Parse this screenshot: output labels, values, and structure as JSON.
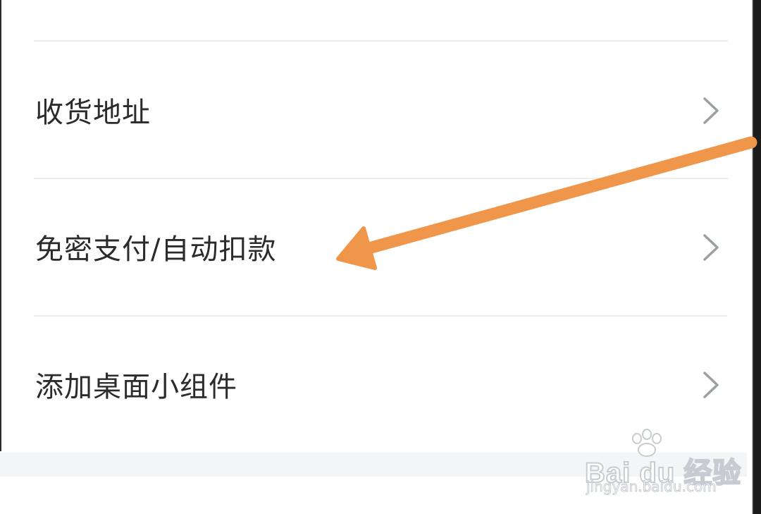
{
  "menu": {
    "items": [
      {
        "label": "收货地址",
        "chevron_icon": "chevron-right-icon"
      },
      {
        "label": "免密支付/自动扣款",
        "chevron_icon": "chevron-right-icon"
      },
      {
        "label": "添加桌面小组件",
        "chevron_icon": "chevron-right-icon"
      }
    ]
  },
  "annotation": {
    "arrow_color": "#F0964A",
    "points_to": "免密支付/自动扣款"
  },
  "watermark": {
    "brand": "Bai du 经验",
    "url": "jingyan.baidu.com"
  },
  "colors": {
    "text": "#2B2B2B",
    "divider": "#ECEEF0",
    "chevron": "#9AA0A6",
    "band": "#F4F5F6"
  }
}
